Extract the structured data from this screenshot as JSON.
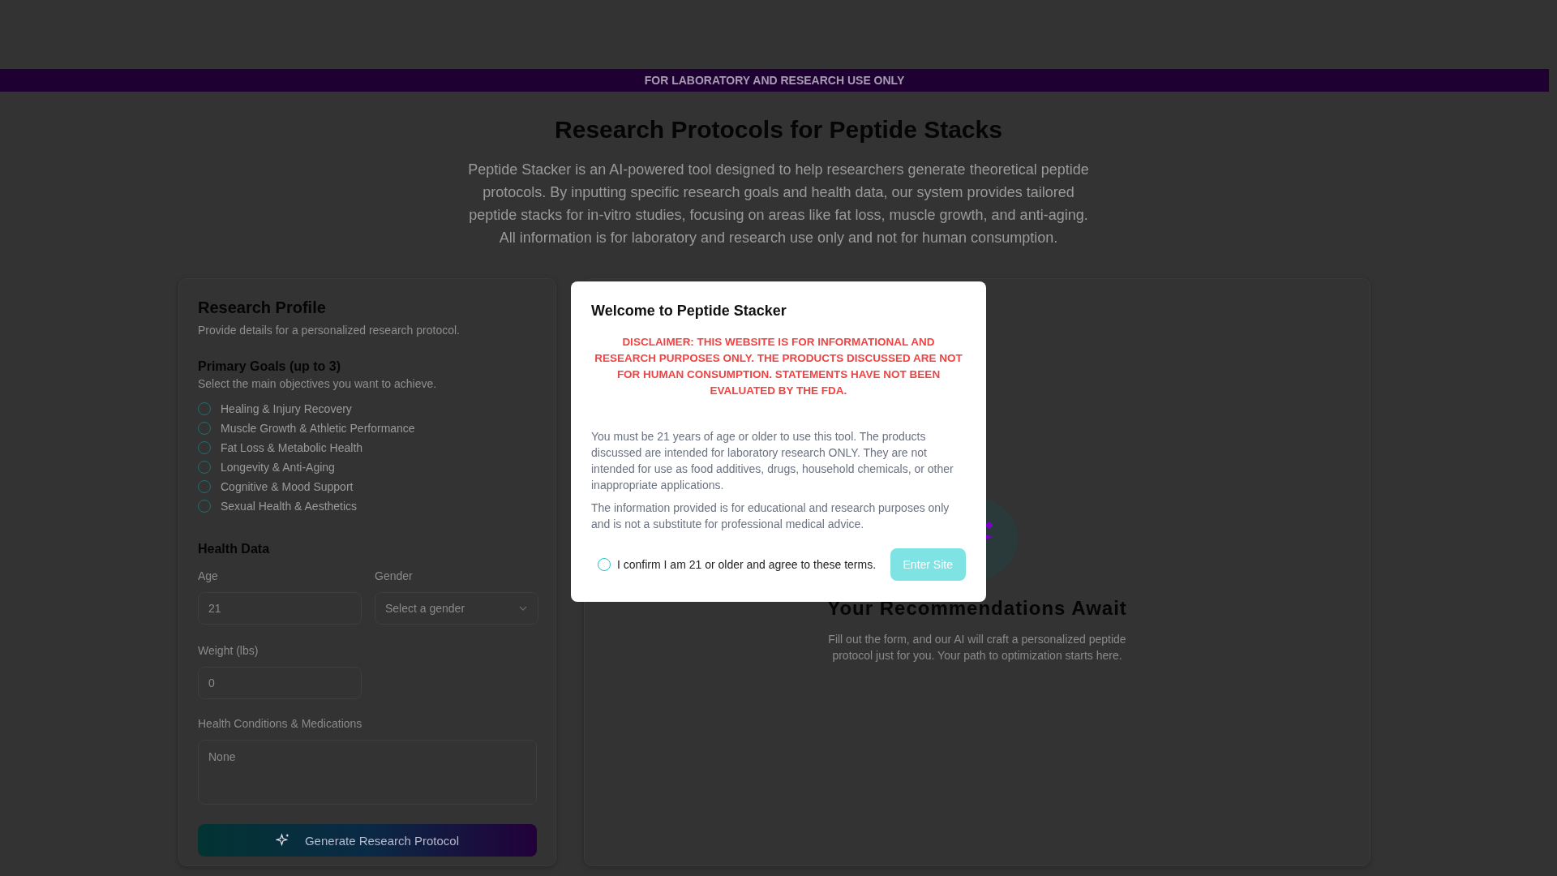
{
  "banner": {
    "text": "FOR LABORATORY AND RESEARCH USE ONLY"
  },
  "hero": {
    "title": "Research Protocols for Peptide Stacks",
    "description": "Peptide Stacker is an AI-powered tool designed to help researchers generate theoretical peptide protocols. By inputting specific research goals and health data, our system provides tailored peptide stacks for in-vitro studies, focusing on areas like fat loss, muscle growth, and anti-aging. All information is for laboratory and research use only and not for human consumption."
  },
  "profile": {
    "title": "Research Profile",
    "subtitle": "Provide details for a personalized research protocol.",
    "goals_title": "Primary Goals (up to 3)",
    "goals_subtitle": "Select the main objectives you want to achieve.",
    "goals": [
      {
        "label": "Healing & Injury Recovery",
        "checked": false
      },
      {
        "label": "Muscle Growth & Athletic Performance",
        "checked": false
      },
      {
        "label": "Fat Loss & Metabolic Health",
        "checked": false
      },
      {
        "label": "Longevity & Anti-Aging",
        "checked": false
      },
      {
        "label": "Cognitive & Mood Support",
        "checked": false
      },
      {
        "label": "Sexual Health & Aesthetics",
        "checked": false
      }
    ],
    "health_title": "Health Data",
    "age": {
      "label": "Age",
      "value": "21"
    },
    "gender": {
      "label": "Gender",
      "placeholder": "Select a gender"
    },
    "weight": {
      "label": "Weight (lbs)",
      "value": "0"
    },
    "conditions": {
      "label": "Health Conditions & Medications",
      "value": "None"
    },
    "submit": "Generate Research Protocol"
  },
  "results": {
    "title": "Your Recommendations Await",
    "text": "Fill out the form, and our AI will craft a personalized peptide protocol just for you. Your path to optimization starts here."
  },
  "modal": {
    "title": "Welcome to Peptide Stacker",
    "disclaimer": "DISCLAIMER: THIS WEBSITE IS FOR INFORMATIONAL AND RESEARCH PURPOSES ONLY. THE PRODUCTS DISCUSSED ARE NOT FOR HUMAN CONSUMPTION. STATEMENTS HAVE NOT BEEN EVALUATED BY THE FDA.",
    "paragraphs": [
      "You must be 21 years of age or older to use this tool. The products discussed are intended for laboratory research ONLY. They are not intended for use as food additives, drugs, household chemicals, or other inappropriate applications.",
      "The information provided is for educational and research purposes only and is not a substitute for professional medical advice."
    ],
    "confirm": {
      "label": "I confirm I am 21 or older and agree to these terms.",
      "checked": false
    },
    "enter": {
      "label": "Enter Site",
      "disabled": true
    }
  }
}
